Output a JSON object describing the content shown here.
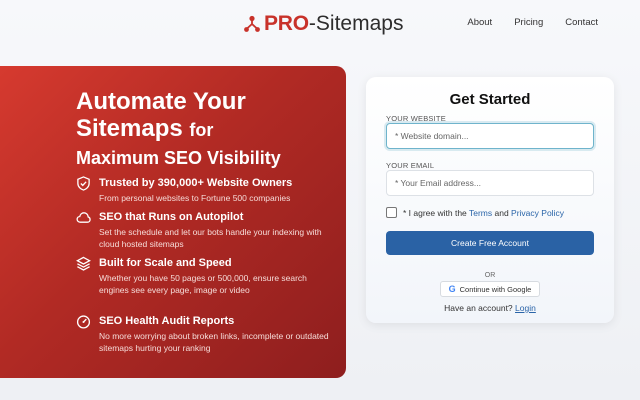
{
  "header": {
    "logo_bold": "PRO",
    "logo_rest": "-Sitemaps",
    "nav": [
      "About",
      "Pricing",
      "Contact"
    ]
  },
  "hero": {
    "title_line1": "Automate Your",
    "title_line2": "Sitemaps",
    "title_for": "for",
    "title_line3": "Maximum SEO Visibility",
    "features": [
      {
        "icon": "shield-check-icon",
        "title": "Trusted by 390,000+ Website Owners",
        "desc": "From personal websites to Fortune 500 companies"
      },
      {
        "icon": "cloud-icon",
        "title": "SEO that Runs on Autopilot",
        "desc": "Set the schedule and let our bots handle your indexing with cloud hosted sitemaps"
      },
      {
        "icon": "layers-icon",
        "title": "Built for Scale and Speed",
        "desc": "Whether you have 50 pages or 500,000, ensure search engines see every page, image or video"
      },
      {
        "icon": "gauge-icon",
        "title": "SEO Health Audit Reports",
        "desc": "No more worrying about broken links, incomplete or outdated sitemaps hurting your ranking"
      }
    ]
  },
  "form": {
    "title": "Get Started",
    "website_label": "YOUR WEBSITE",
    "website_placeholder": "* Website domain...",
    "website_value": "",
    "email_label": "YOUR EMAIL",
    "email_placeholder": "* Your Email address...",
    "email_value": "",
    "agree_prefix": "* I agree with the ",
    "terms": "Terms",
    "and": " and ",
    "privacy": "Privacy Policy",
    "checked": false,
    "submit": "Create Free Account",
    "or": "OR",
    "google": "Continue with Google",
    "have_account": "Have an account? ",
    "login": "Login"
  },
  "colors": {
    "brand_red": "#c8322a",
    "button_blue": "#2a62a5",
    "link_blue": "#2a64a8"
  }
}
